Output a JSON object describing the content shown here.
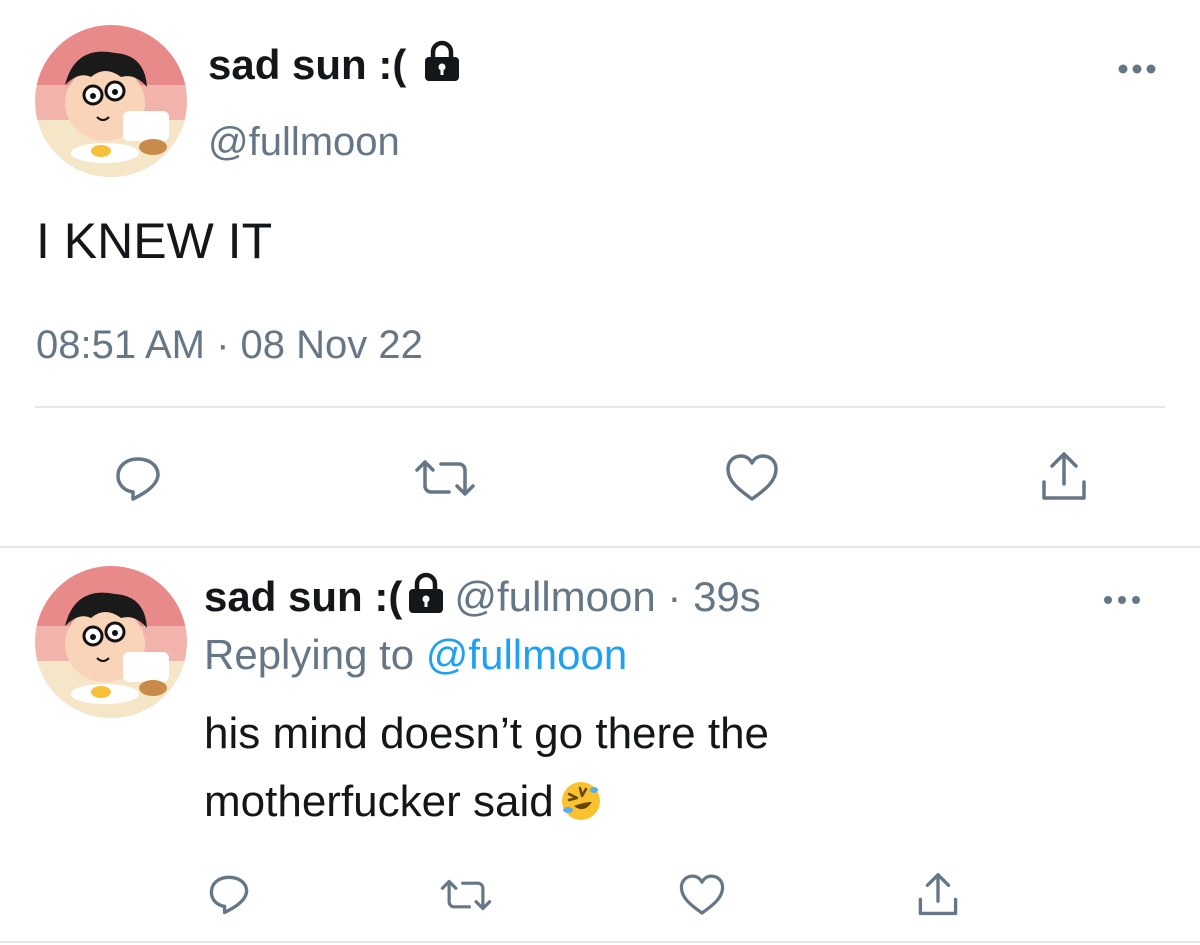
{
  "tweet": {
    "display_name": "sad sun :(",
    "handle": "@fullmoon",
    "text": "I KNEW IT",
    "timestamp": "08:51 AM · 08 Nov 22"
  },
  "reply": {
    "display_name": "sad sun :(",
    "meta": "@fullmoon · 39s",
    "replying_prefix": "Replying to",
    "replying_to": "@fullmoon",
    "text_line1": "his mind doesn’t go there the",
    "text_line2": "motherfucker said",
    "emoji": "rolling-on-floor-laughing-emoji"
  },
  "icons": {
    "lock": "lock-icon",
    "more": "more-horizontal-icon",
    "reply": "reply-icon",
    "retweet": "retweet-icon",
    "like": "heart-icon",
    "share": "share-icon"
  },
  "colors": {
    "text": "#14171a",
    "secondary": "#657786",
    "link": "#1da1f2",
    "divider": "#e1e8ed"
  }
}
